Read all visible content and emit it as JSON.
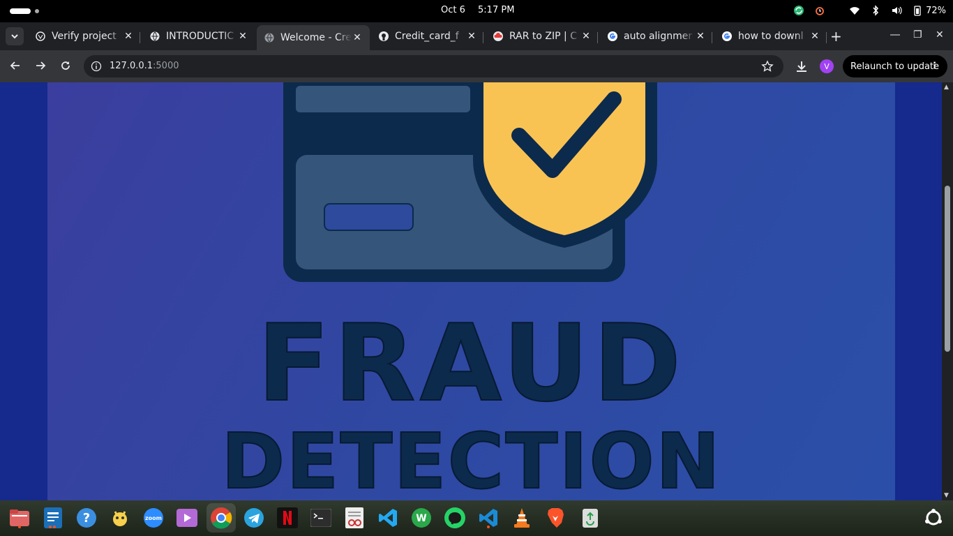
{
  "system_bar": {
    "date": "Oct 6",
    "time": "5:17 PM",
    "battery": "72%"
  },
  "tabs": [
    {
      "title": "Verify project",
      "icon": "openai-icon",
      "active": false
    },
    {
      "title": "INTRODUCTIC",
      "icon": "globe-icon",
      "active": false
    },
    {
      "title": "Welcome - Cre",
      "icon": "globe-icon",
      "active": true
    },
    {
      "title": "Credit_card_f",
      "icon": "github-icon",
      "active": false
    },
    {
      "title": "RAR to ZIP | C",
      "icon": "cloud-icon",
      "active": false
    },
    {
      "title": "auto alignmer",
      "icon": "google-icon",
      "active": false
    },
    {
      "title": "how to downl",
      "icon": "google-icon",
      "active": false
    }
  ],
  "address_bar": {
    "host": "127.0.0.1",
    "port": ":5000"
  },
  "profile": {
    "initial": "V"
  },
  "relaunch": {
    "label": "Relaunch to update"
  },
  "page": {
    "headline": "FRAUD",
    "subheadline": "DETECTION"
  },
  "colors": {
    "page_background": "#2f48a2",
    "card_dark": "#0c2a4c",
    "card_body": "#36557a",
    "shield": "#f9c353",
    "chip": "#2d4a9c"
  },
  "dock": [
    "files-icon",
    "text-editor-icon",
    "help-icon",
    "pet-app-icon",
    "zoom-icon",
    "video-player-icon",
    "chrome-icon",
    "telegram-icon",
    "netflix-icon",
    "terminal-icon",
    "document-viewer-icon",
    "vscode-icon",
    "wps-icon",
    "whatsapp-icon",
    "vscode-insiders-icon",
    "vlc-icon",
    "brave-icon",
    "trash-icon"
  ],
  "dock_zoom_label": "zoom"
}
